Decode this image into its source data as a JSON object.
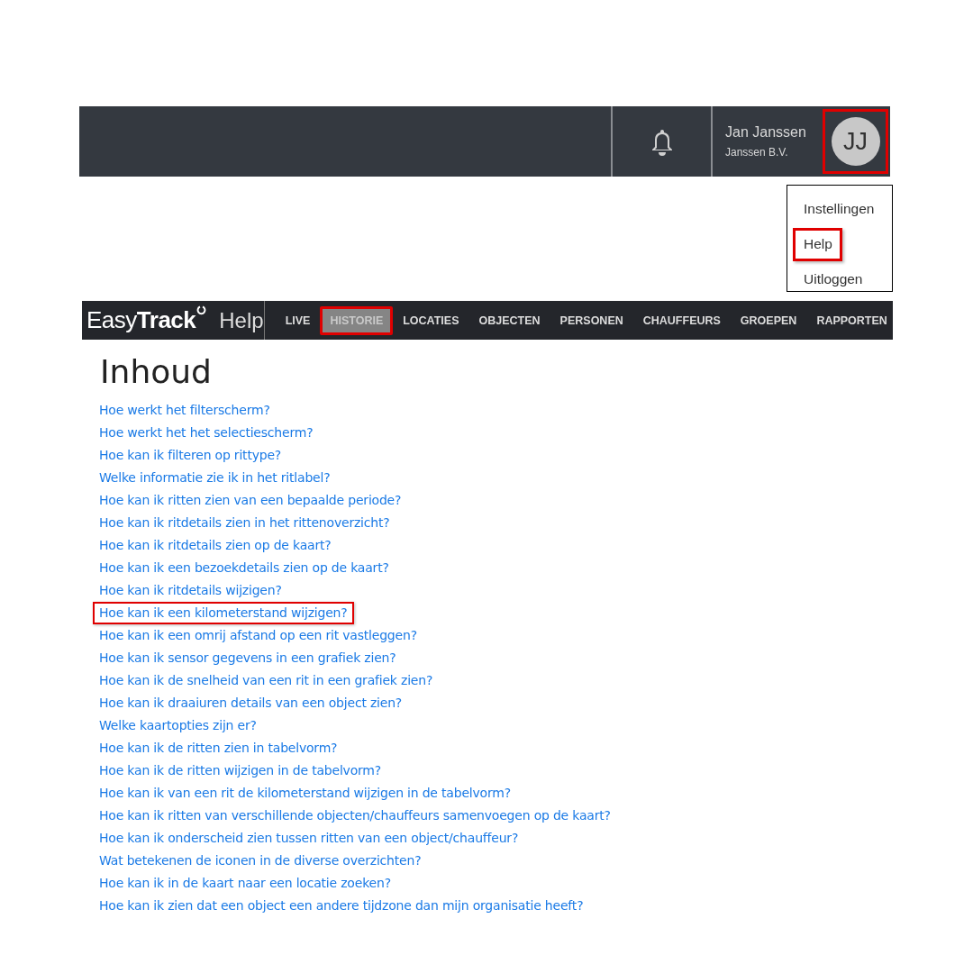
{
  "header": {
    "user_name": "Jan Janssen",
    "company": "Janssen B.V.",
    "avatar_initials": "JJ",
    "avatar_highlighted": true
  },
  "user_menu": [
    {
      "label": "Instellingen",
      "highlighted": false
    },
    {
      "label": "Help",
      "highlighted": true
    },
    {
      "label": "Uitloggen",
      "highlighted": false
    }
  ],
  "navbar": {
    "logo": "Easy**Track**",
    "section": "Help",
    "tabs": [
      {
        "label": "LIVE",
        "selected": false,
        "highlighted": false
      },
      {
        "label": "HISTORIE",
        "selected": true,
        "highlighted": true
      },
      {
        "label": "LOCATIES",
        "selected": false,
        "highlighted": false
      },
      {
        "label": "OBJECTEN",
        "selected": false,
        "highlighted": false
      },
      {
        "label": "PERSONEN",
        "selected": false,
        "highlighted": false
      },
      {
        "label": "CHAUFFEURS",
        "selected": false,
        "highlighted": false
      },
      {
        "label": "GROEPEN",
        "selected": false,
        "highlighted": false
      },
      {
        "label": "RAPPORTEN",
        "selected": false,
        "highlighted": false
      }
    ]
  },
  "contents": {
    "title": "Inhoud",
    "links": [
      {
        "text": "Hoe werkt het filterscherm?",
        "highlighted": false
      },
      {
        "text": "Hoe werkt het het selectiescherm?",
        "highlighted": false
      },
      {
        "text": "Hoe kan ik filteren op rittype?",
        "highlighted": false
      },
      {
        "text": "Welke informatie zie ik in het ritlabel?",
        "highlighted": false
      },
      {
        "text": "Hoe kan ik ritten zien van een bepaalde periode?",
        "highlighted": false
      },
      {
        "text": "Hoe kan ik ritdetails zien in het rittenoverzicht?",
        "highlighted": false
      },
      {
        "text": "Hoe kan ik ritdetails zien op de kaart?",
        "highlighted": false
      },
      {
        "text": "Hoe kan ik een bezoekdetails zien op de kaart?",
        "highlighted": false
      },
      {
        "text": "Hoe kan ik ritdetails wijzigen?",
        "highlighted": false
      },
      {
        "text": "Hoe kan ik een kilometerstand wijzigen?",
        "highlighted": true
      },
      {
        "text": "Hoe kan ik een omrij afstand op een rit vastleggen?",
        "highlighted": false
      },
      {
        "text": "Hoe kan ik sensor gegevens in een grafiek zien?",
        "highlighted": false
      },
      {
        "text": "Hoe kan ik de snelheid van een rit in een grafiek zien?",
        "highlighted": false
      },
      {
        "text": "Hoe kan ik draaiuren details van een object zien?",
        "highlighted": false
      },
      {
        "text": "Welke kaartopties zijn er?",
        "highlighted": false
      },
      {
        "text": "Hoe kan ik de ritten zien in tabelvorm?",
        "highlighted": false
      },
      {
        "text": "Hoe kan ik de ritten wijzigen in de tabelvorm?",
        "highlighted": false
      },
      {
        "text": "Hoe kan ik van een rit de kilometerstand wijzigen in de tabelvorm?",
        "highlighted": false
      },
      {
        "text": "Hoe kan ik ritten van verschillende objecten/chauffeurs samenvoegen op de kaart?",
        "highlighted": false
      },
      {
        "text": "Hoe kan ik onderscheid zien tussen ritten van een object/chauffeur?",
        "highlighted": false
      },
      {
        "text": "Wat betekenen de iconen in de diverse overzichten?",
        "highlighted": false
      },
      {
        "text": "Hoe kan ik in de kaart naar een locatie zoeken?",
        "highlighted": false
      },
      {
        "text": "Hoe kan ik zien dat een object een andere tijdzone dan mijn organisatie heeft?",
        "highlighted": false
      }
    ]
  }
}
